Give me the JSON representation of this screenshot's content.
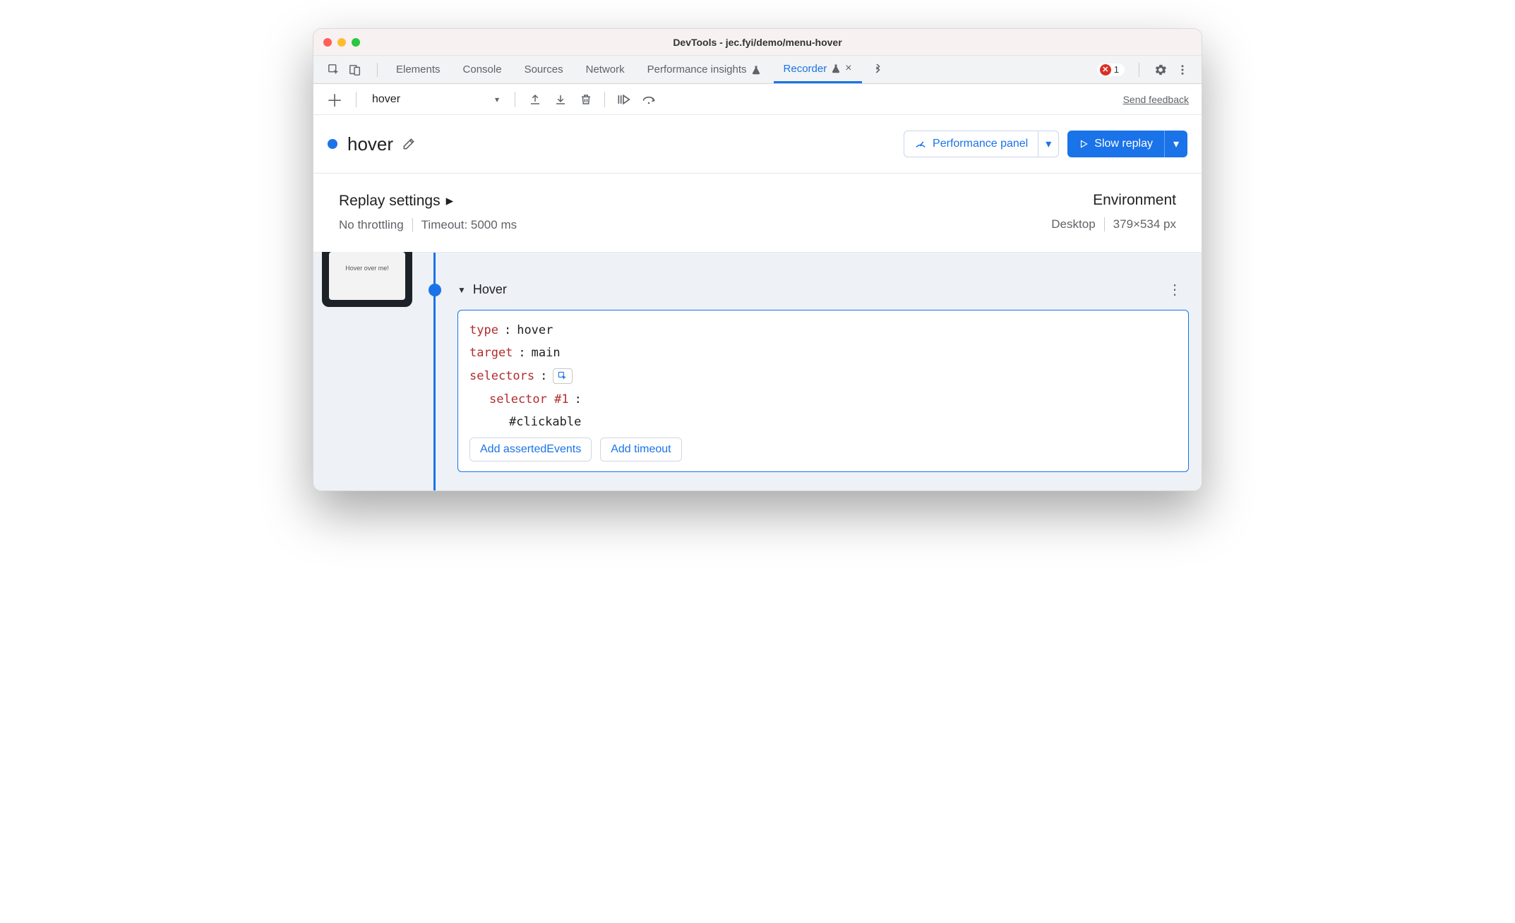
{
  "window": {
    "title": "DevTools - jec.fyi/demo/menu-hover"
  },
  "tabs": {
    "items": [
      "Elements",
      "Console",
      "Sources",
      "Network",
      "Performance insights",
      "Recorder"
    ],
    "active": "Recorder"
  },
  "errors": {
    "count": "1"
  },
  "toolbar": {
    "recording_name": "hover",
    "feedback": "Send feedback"
  },
  "header": {
    "title": "hover",
    "perf_button": "Performance panel",
    "replay_button": "Slow replay"
  },
  "settings": {
    "heading": "Replay settings",
    "throttling": "No throttling",
    "timeout": "Timeout: 5000 ms",
    "env_heading": "Environment",
    "device": "Desktop",
    "dimensions": "379×534 px"
  },
  "thumbnail": {
    "caption": "Hover over me!"
  },
  "step": {
    "title": "Hover",
    "type_key": "type",
    "type_val": "hover",
    "target_key": "target",
    "target_val": "main",
    "selectors_key": "selectors",
    "selector_row": "selector #1",
    "selector_value": "#clickable",
    "add_asserted": "Add assertedEvents",
    "add_timeout": "Add timeout"
  }
}
